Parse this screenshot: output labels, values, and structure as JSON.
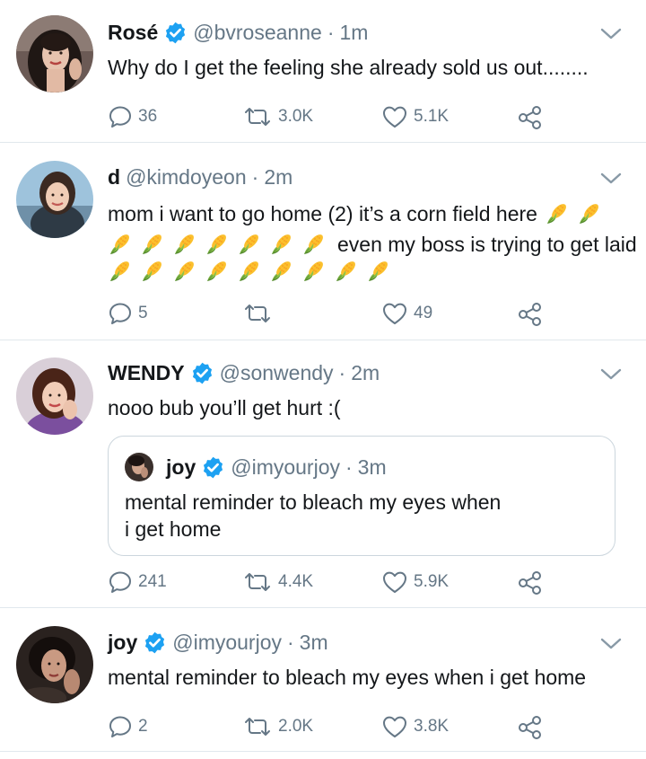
{
  "tweets": [
    {
      "name": "Rosé",
      "verified": true,
      "handle": "@bvroseanne",
      "sep": "·",
      "time": "1m",
      "text": "Why do I get the feeling she already sold us out........",
      "replies": "36",
      "retweets": "3.0K",
      "likes": "5.1K"
    },
    {
      "name": "d",
      "verified": false,
      "handle": "@kimdoyeon",
      "sep": "·",
      "time": "2m",
      "text_line1": "mom i want to go home (2) it’s a corn field here",
      "text_line2": "even my boss is trying to get laid",
      "corn_emoji": "🌽",
      "replies": "5",
      "retweets": "",
      "likes": "49"
    },
    {
      "name": "WENDY",
      "verified": true,
      "handle": "@sonwendy",
      "sep": "·",
      "time": "2m",
      "text": "nooo bub you’ll get hurt :(",
      "quote": {
        "name": "joy",
        "verified": true,
        "handle": "@imyourjoy",
        "sep": "·",
        "time": "3m",
        "text_line1": "mental reminder to bleach my eyes when",
        "text_line2": "i get home"
      },
      "replies": "241",
      "retweets": "4.4K",
      "likes": "5.9K"
    },
    {
      "name": "joy",
      "verified": true,
      "handle": "@imyourjoy",
      "sep": "·",
      "time": "3m",
      "text": "mental reminder to bleach my eyes when i get home",
      "replies": "2",
      "retweets": "2.0K",
      "likes": "3.8K"
    }
  ],
  "icons": {
    "reply": "reply-icon",
    "retweet": "retweet-icon",
    "like": "heart-icon",
    "share": "share-icon",
    "verified": "verified-badge-icon",
    "menu": "chevron-down-icon"
  },
  "colors": {
    "verified_blue": "#1da1f2",
    "muted_gray": "#657786",
    "divider": "#e1e8ed"
  }
}
